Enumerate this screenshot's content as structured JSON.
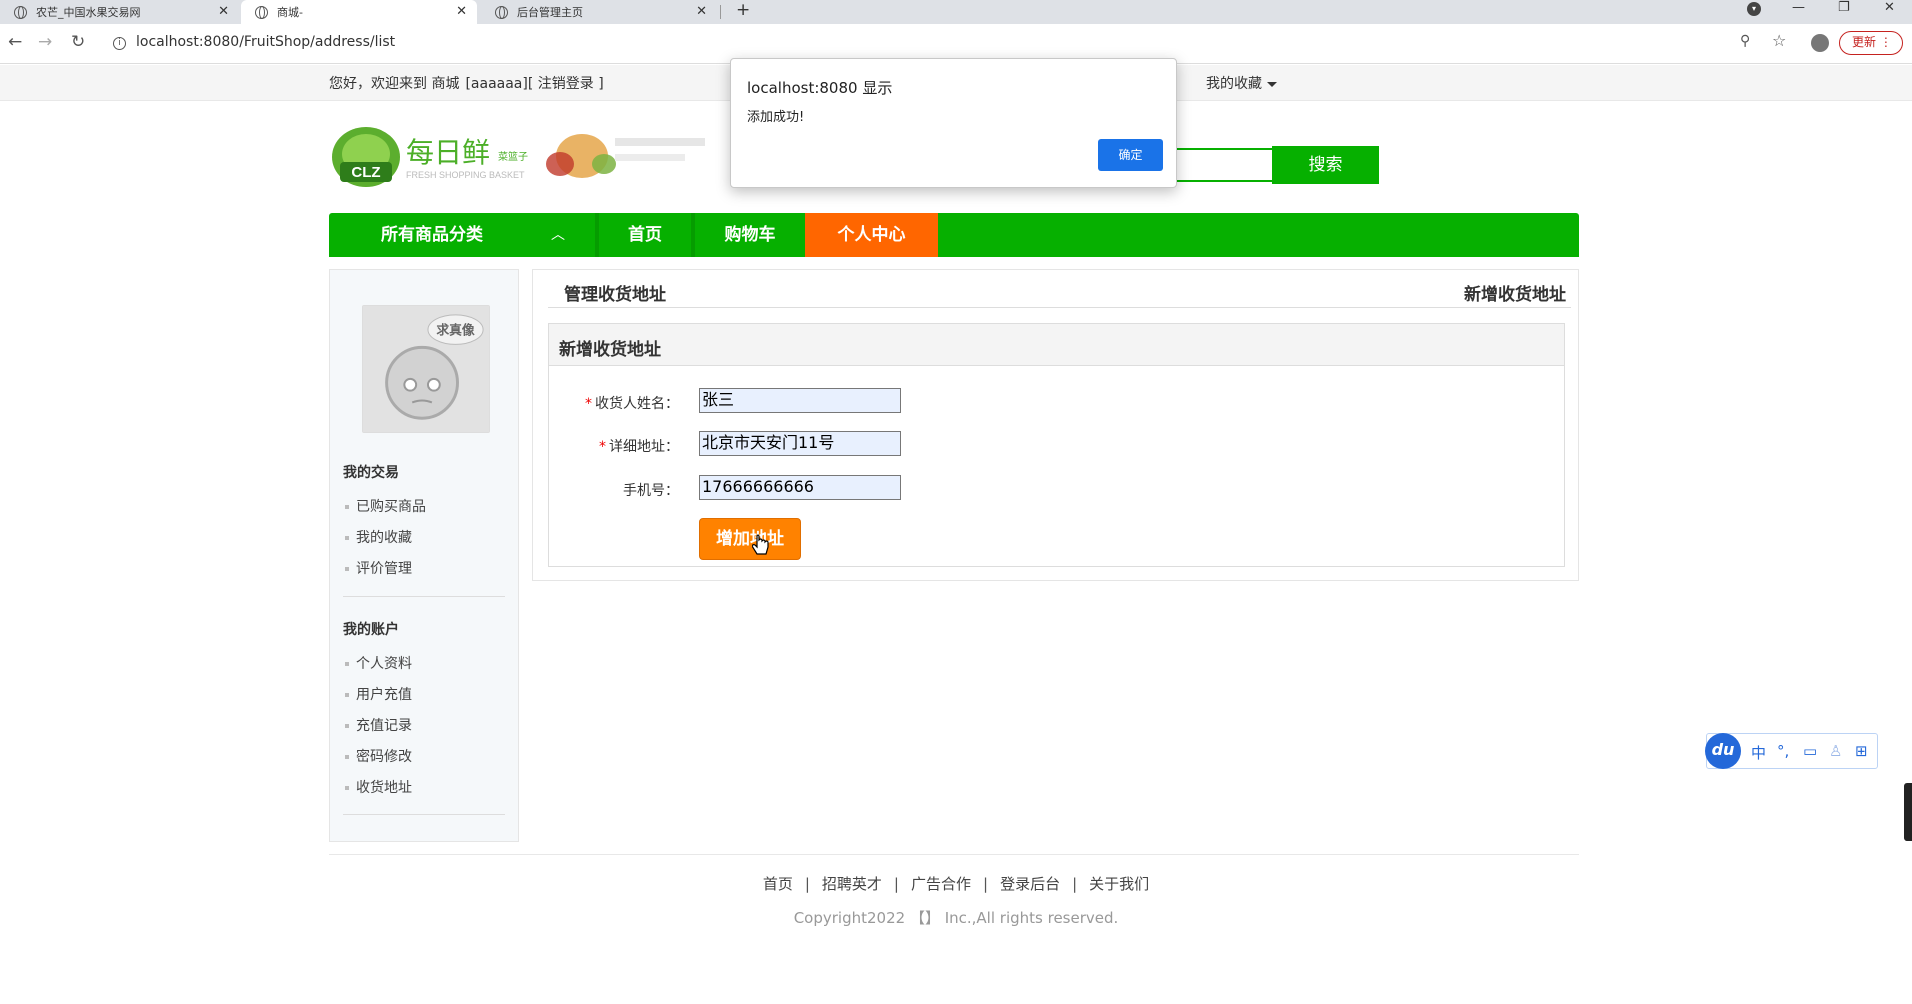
{
  "browser": {
    "tabs": [
      {
        "title": "农芒_中国水果交易网"
      },
      {
        "title": "商城-"
      },
      {
        "title": "后台管理主页"
      }
    ],
    "url": "localhost:8080/FruitShop/address/list",
    "update_label": "更新"
  },
  "topbar": {
    "greeting": "您好，欢迎来到 商城",
    "username": "[aaaaaa]",
    "logout": "[ 注销登录 ]",
    "favorites": "我的收藏"
  },
  "header": {
    "logo_text": "每日鲜",
    "logo_sub": "菜篮子",
    "logo_badge": "CLZ",
    "logo_tagline": "FRESH SHOPPING BASKET",
    "search_button": "搜索"
  },
  "nav": {
    "categories": "所有商品分类",
    "items": [
      "首页",
      "购物车",
      "个人中心"
    ]
  },
  "sidebar": {
    "avatar_caption": "求真像",
    "section1_title": "我的交易",
    "section1_links": [
      "已购买商品",
      "我的收藏",
      "评价管理"
    ],
    "section2_title": "我的账户",
    "section2_links": [
      "个人资料",
      "用户充值",
      "充值记录",
      "密码修改",
      "收货地址"
    ]
  },
  "main": {
    "title": "管理收货地址",
    "new_link": "新增收货地址",
    "form_title": "新增收货地址",
    "fields": [
      {
        "label": "收货人姓名：",
        "required": true,
        "value": "张三"
      },
      {
        "label": "详细地址：",
        "required": true,
        "value": "北京市天安门11号"
      },
      {
        "label": "手机号：",
        "required": false,
        "value": "17666666666"
      }
    ],
    "submit": "增加地址"
  },
  "footer": {
    "links": [
      "首页",
      "招聘英才",
      "广告合作",
      "登录后台",
      "关于我们"
    ],
    "copyright": "Copyright2022 【】 Inc.,All rights reserved."
  },
  "alert": {
    "title": "localhost:8080 显示",
    "message": "添加成功!",
    "ok": "确定"
  },
  "ime": {
    "logo": "du",
    "mode": "中"
  },
  "colors": {
    "brand_green": "#06b000",
    "active_orange": "#ff6600",
    "button_orange": "#ff8200",
    "dialog_blue": "#1a73e8"
  }
}
